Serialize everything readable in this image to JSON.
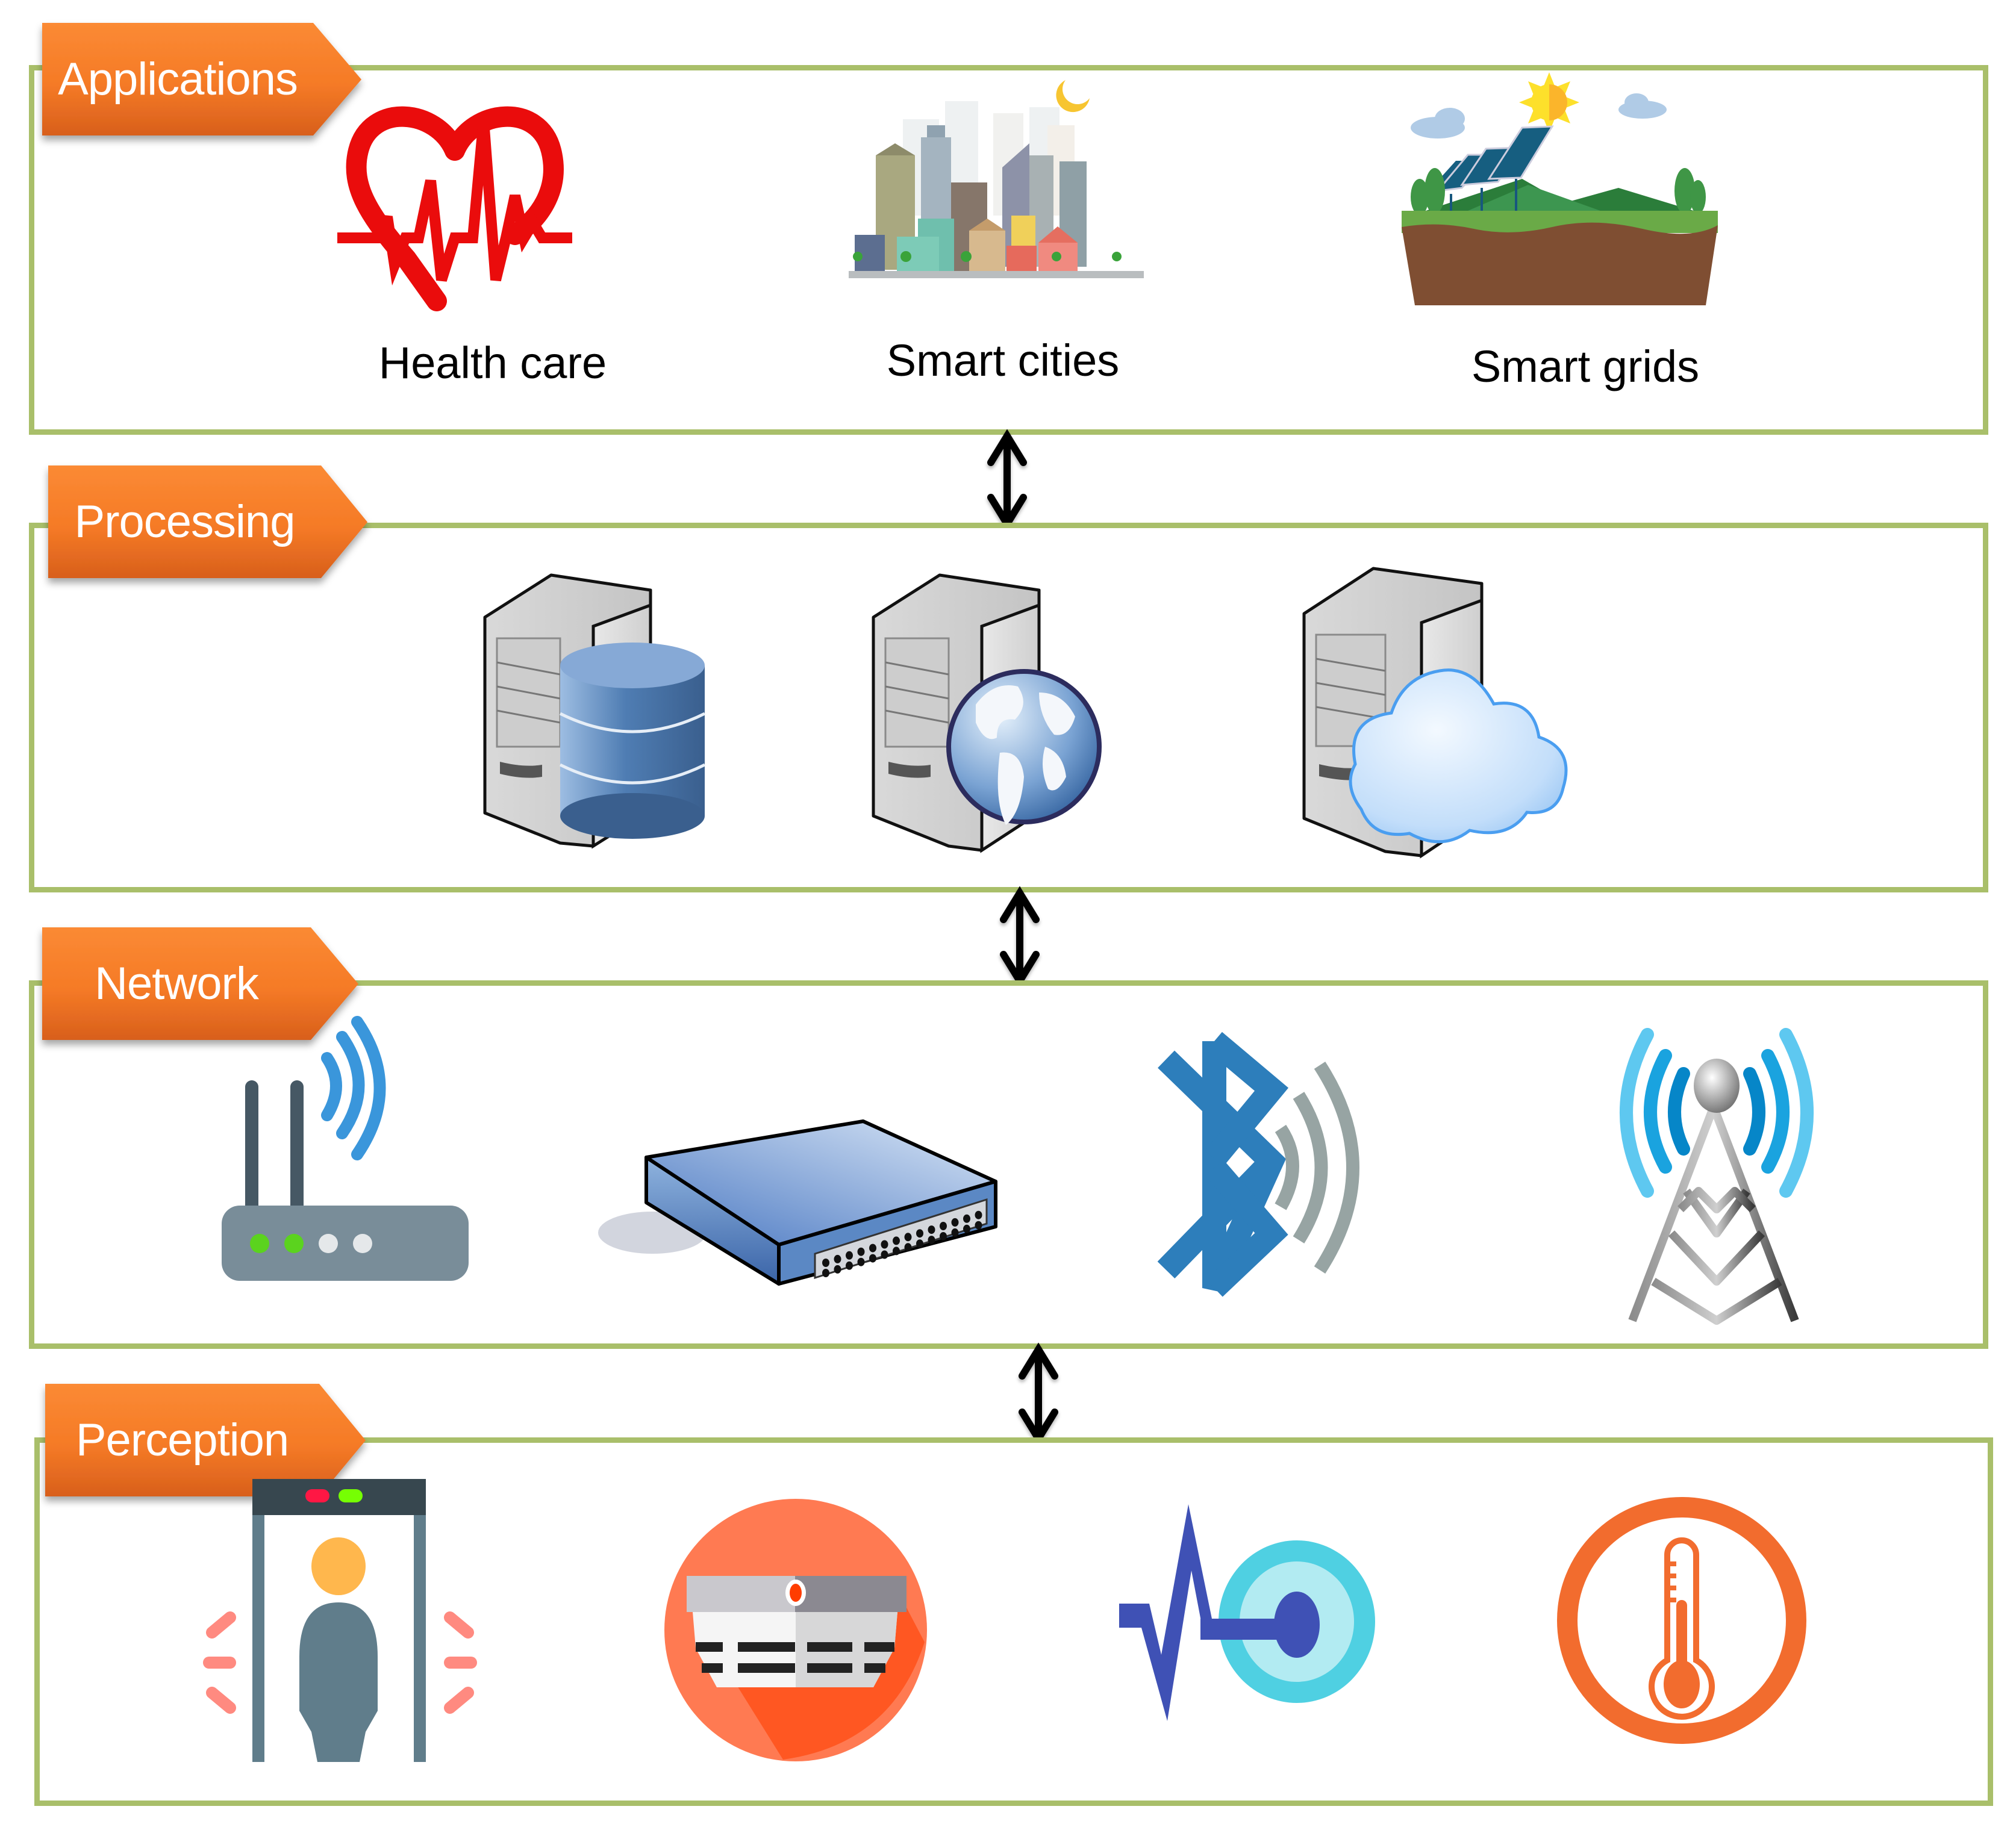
{
  "colors": {
    "layer_border": "#a9bf6a",
    "tag_fill_top": "#fb8a34",
    "tag_fill_bottom": "#d85f1c",
    "tag_text": "#ffffff",
    "arrow": "#000000"
  },
  "layers": [
    {
      "id": "applications",
      "label": "Applications",
      "items": [
        {
          "icon": "heartbeat-icon",
          "caption": "Health care"
        },
        {
          "icon": "smart-city-icon",
          "caption": "Smart cities"
        },
        {
          "icon": "solar-grid-icon",
          "caption": "Smart grids"
        }
      ]
    },
    {
      "id": "processing",
      "label": "Processing",
      "items": [
        {
          "icon": "database-server-icon"
        },
        {
          "icon": "web-server-icon"
        },
        {
          "icon": "cloud-server-icon"
        }
      ]
    },
    {
      "id": "network",
      "label": "Network",
      "items": [
        {
          "icon": "wifi-router-icon"
        },
        {
          "icon": "network-switch-icon"
        },
        {
          "icon": "bluetooth-icon"
        },
        {
          "icon": "cell-tower-icon"
        }
      ]
    },
    {
      "id": "perception",
      "label": "Perception",
      "items": [
        {
          "icon": "metal-detector-icon"
        },
        {
          "icon": "smoke-detector-icon"
        },
        {
          "icon": "vital-sign-sensor-icon"
        },
        {
          "icon": "temperature-sensor-icon"
        }
      ]
    }
  ],
  "connectors": [
    {
      "from": "applications",
      "to": "processing",
      "type": "bidirectional"
    },
    {
      "from": "processing",
      "to": "network",
      "type": "bidirectional"
    },
    {
      "from": "network",
      "to": "perception",
      "type": "bidirectional"
    }
  ]
}
